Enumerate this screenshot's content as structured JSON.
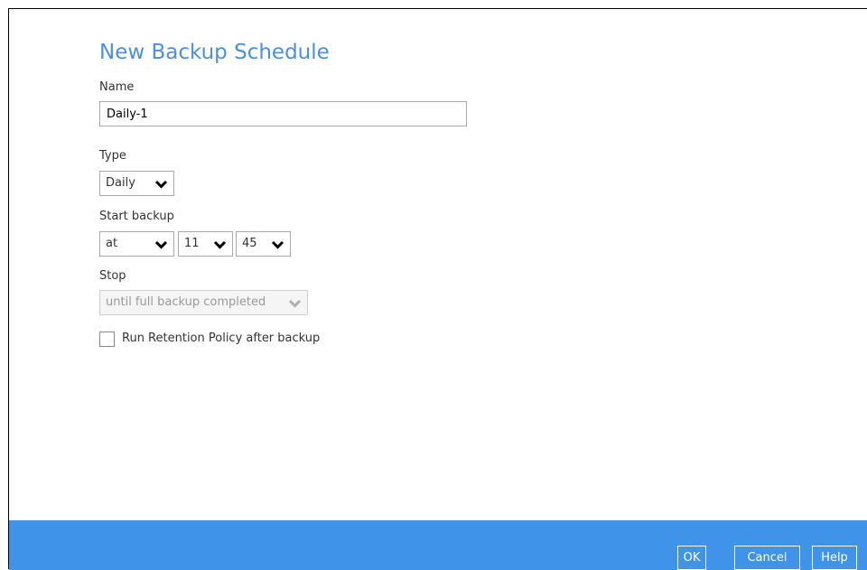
{
  "dialog": {
    "title": "New Backup Schedule"
  },
  "name_field": {
    "label": "Name",
    "value": "Daily-1"
  },
  "type_field": {
    "label": "Type",
    "value": "Daily"
  },
  "start_backup": {
    "label": "Start backup",
    "mode": "at",
    "hour": "11",
    "separator": ":",
    "minute": "45"
  },
  "stop": {
    "label": "Stop",
    "value": "until full backup completed",
    "disabled": true
  },
  "retention": {
    "label": "Run Retention Policy after backup",
    "checked": false
  },
  "buttons": {
    "ok": "OK",
    "cancel": "Cancel",
    "help": "Help"
  },
  "colors": {
    "accent": "#4a90e2",
    "footer": "#3f93e8"
  }
}
